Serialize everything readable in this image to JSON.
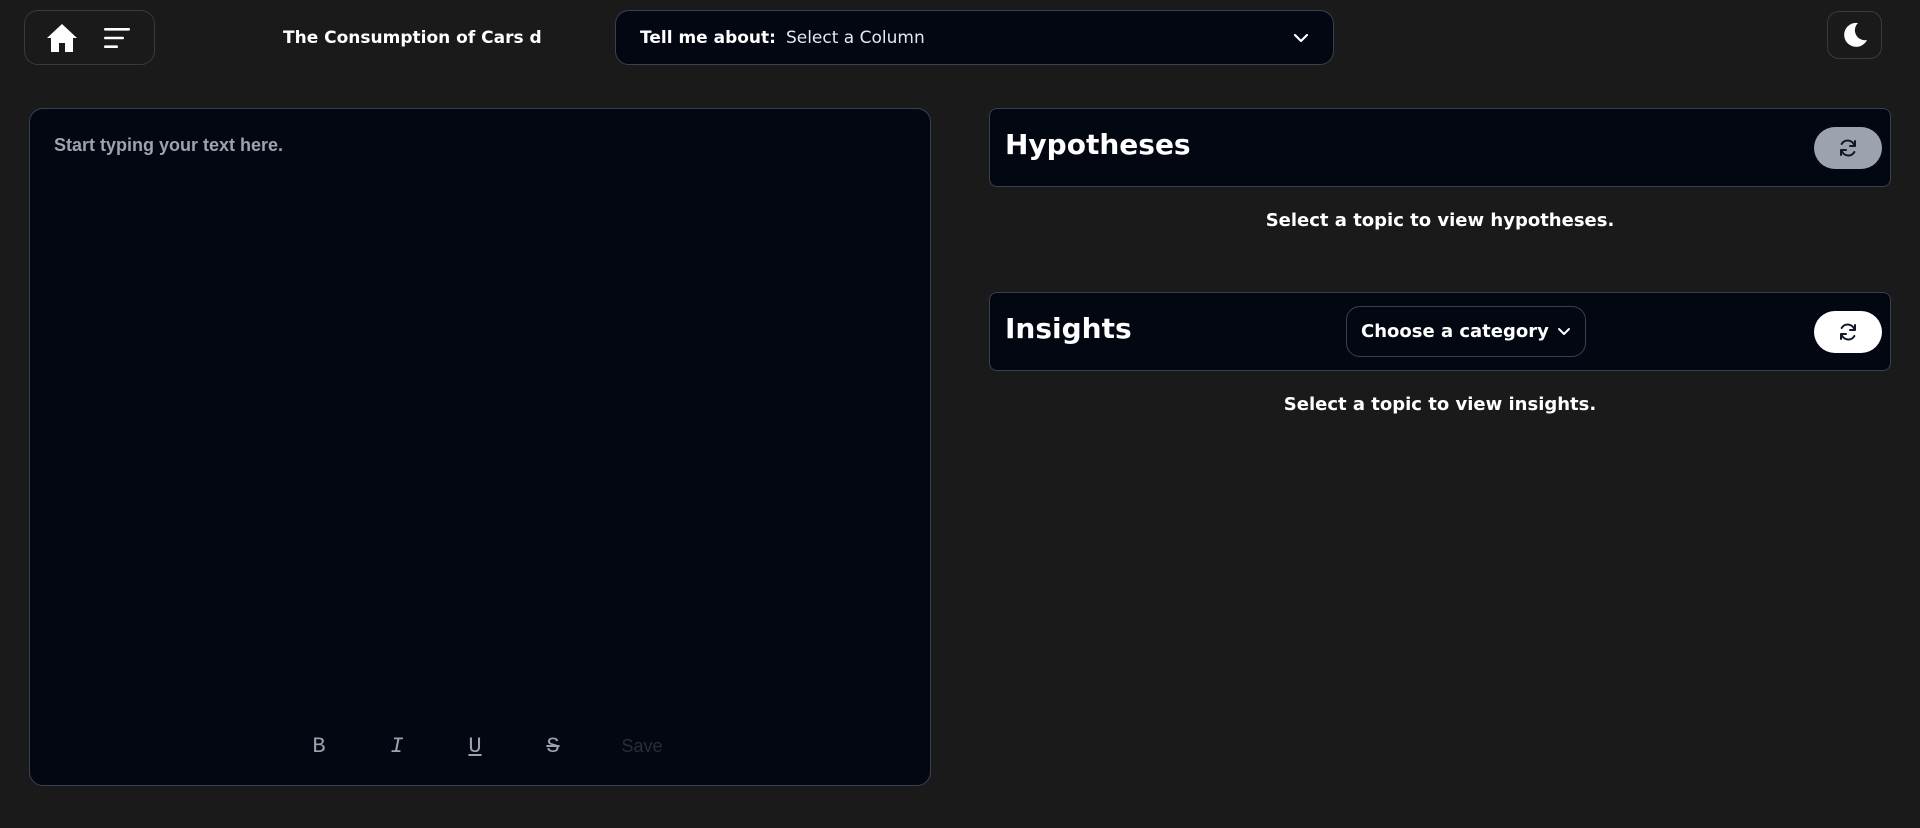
{
  "header": {
    "doc_title": "The Consumption of Cars during",
    "column_select": {
      "label": "Tell me about:",
      "value": "Select a Column"
    }
  },
  "editor": {
    "placeholder": "Start typing your text here.",
    "toolbar": {
      "bold": "B",
      "italic": "I",
      "underline": "U",
      "strike": "S",
      "save": "Save"
    }
  },
  "hypotheses": {
    "title": "Hypotheses",
    "empty_message": "Select a topic to view hypotheses."
  },
  "insights": {
    "title": "Insights",
    "category_select": "Choose a category",
    "empty_message": "Select a topic to view insights."
  }
}
